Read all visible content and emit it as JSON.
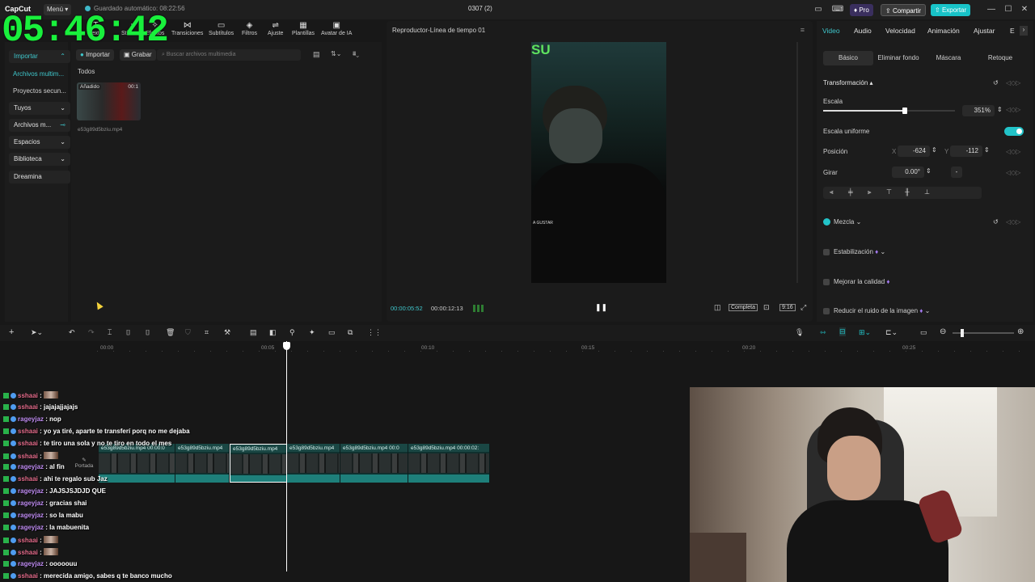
{
  "app": {
    "logo": "CapCut",
    "menu_label": "Menú",
    "autosave": "Guardado automático: 08:22:56",
    "project_name": "0307 (2)",
    "pro_label": "Pro",
    "share_label": "Compartir",
    "export_label": "Exportar"
  },
  "overlay": {
    "clock": "05:46:42"
  },
  "toolbar": {
    "items": [
      "Texto",
      "Stickers",
      "Efectos",
      "Transiciones",
      "Subtítulos",
      "Filtros",
      "Ajuste",
      "Plantillas",
      "Avatar de IA"
    ]
  },
  "leftnav": {
    "import": "Importar",
    "items": [
      "Archivos multim...",
      "Proyectos secun...",
      "Tuyos",
      "Archivos m...",
      "Espacios",
      "Biblioteca",
      "Dreamina"
    ]
  },
  "media": {
    "import_btn": "Importar",
    "record_btn": "Grabar",
    "search_placeholder": "Buscar archivos multimedia",
    "section": "Todos",
    "thumb_badge": "Añadido",
    "thumb_duration": "00:1",
    "file_name": "e53g89d5bziu.mp4"
  },
  "player": {
    "title": "Reproductor-Línea de tiempo 01",
    "current_time": "00:00:05:52",
    "total_time": "00:00:12:13",
    "complete_label": "Completa",
    "ratio_label": "9:16",
    "overlay_top": "SU",
    "overlay_mid": "A GUSTAR"
  },
  "inspector": {
    "tabs": [
      "Video",
      "Audio",
      "Velocidad",
      "Animación",
      "Ajustar",
      "E"
    ],
    "subtabs": [
      "Básico",
      "Eliminar fondo",
      "Máscara",
      "Retoque"
    ],
    "transform_label": "Transformación",
    "scale_label": "Escala",
    "scale_value": "351%",
    "scale_fraction": 0.62,
    "uniform_label": "Escala uniforme",
    "position_label": "Posición",
    "pos_x_label": "X",
    "pos_x": "-624",
    "pos_y_label": "Y",
    "pos_y": "-112",
    "rotate_label": "Girar",
    "rotate_value": "0.00°",
    "rotate_extra": "-",
    "blend_label": "Mezcla",
    "stabilize_label": "Estabilización",
    "quality_label": "Mejorar la calidad",
    "noise_label": "Reducir el ruido de la imagen"
  },
  "timeline": {
    "ruler": [
      "00:00",
      "00:05",
      "00:10",
      "00:15",
      "00:20",
      "00:25"
    ],
    "cover_label": "Portada",
    "clips": [
      {
        "label": "e53g89d5bziu.mp4  00:00:0"
      },
      {
        "label": "e53g89d5bziu.mp4"
      },
      {
        "label": "e53g89d5bziu.mp4"
      },
      {
        "label": "e53g89d5bziu.mp4"
      },
      {
        "label": "e53g89d5bziu.mp4  00:0"
      },
      {
        "label": "e53g89d5bziu.mp4  00:00:02:"
      }
    ]
  },
  "chat": [
    {
      "user": "sshaai",
      "msg": ":"
    },
    {
      "user": "sshaai",
      "msg": ": jajajajjajajs"
    },
    {
      "user": "rageyjaz",
      "msg": ": nop"
    },
    {
      "user": "sshaai",
      "msg": ": yo ya tiré, aparte te transferí porq no me dejaba"
    },
    {
      "user": "sshaai",
      "msg": ": te tiro una sola y no te tiro en todo el mes"
    },
    {
      "user": "sshaai",
      "msg": ":"
    },
    {
      "user": "rageyjaz",
      "msg": ": al fin"
    },
    {
      "user": "sshaai",
      "msg": ": ahi te regalo sub Jaz"
    },
    {
      "user": "rageyjaz",
      "msg": ": JAJSJSJDJD QUE"
    },
    {
      "user": "rageyjaz",
      "msg": ": gracias shai"
    },
    {
      "user": "rageyjaz",
      "msg": ": so la mabu"
    },
    {
      "user": "rageyjaz",
      "msg": ": la mabuenita"
    },
    {
      "user": "sshaai",
      "msg": ":"
    },
    {
      "user": "sshaai",
      "msg": ":"
    },
    {
      "user": "rageyjaz",
      "msg": ": ooooouu"
    },
    {
      "user": "sshaai",
      "msg": ": merecida amigo, sabes q te banco mucho"
    }
  ]
}
